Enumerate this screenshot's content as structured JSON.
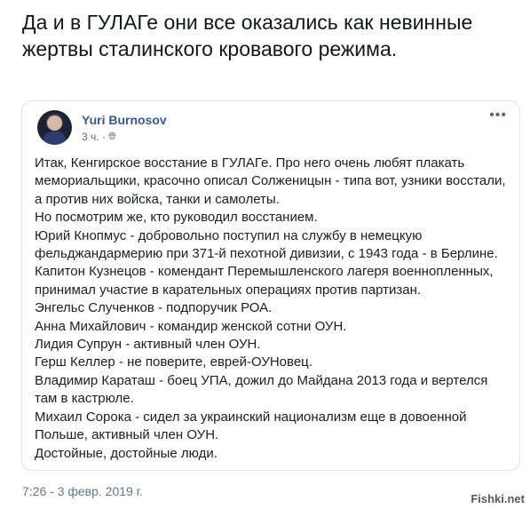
{
  "tweet": {
    "text": "Да и в ГУЛАГе они все оказались как невинные жертвы сталинского кровавого режима.",
    "timestamp": "7:26 - 3 февр. 2019 г."
  },
  "post": {
    "author": "Yuri Burnosov",
    "time": "3 ч. ·",
    "privacy_icon": "globe-icon",
    "more_icon": "more-options-icon",
    "more_label": "•••",
    "lines": [
      "Итак, Кенгирское восстание в ГУЛАГе. Про него очень любят плакать мемориальщики, красочно описал Солженицын - типа вот, узники восстали, а против них войска, танки и самолеты.",
      "Но посмотрим же, кто руководил восстанием.",
      "Юрий Кнопмус - добровольно поступил на службу в немецкую фельджандармерию при 371-й пехотной дивизии, с 1943 года - в Берлине.",
      "Капитон Кузнецов - комендант Перемышленского лагеря военнопленных, принимал участие в карательных операциях против партизан.",
      "Энгельс Слученков - подпоручик РОА.",
      "Анна Михайлович - командир женской сотни ОУН.",
      "Лидия Супрун - активный член ОУН.",
      "Герш Келлер - не поверите, еврей-ОУНовец.",
      "Владимир Караташ - боец УПА, дожил до Майдана 2013 года и вертелся там в кастрюле.",
      "Михаил Сорока - сидел за украинский национализм еще в довоенной Польше, активный член ОУН.",
      "Достойные, достойные люди."
    ]
  },
  "watermark": "Fishki.net"
}
